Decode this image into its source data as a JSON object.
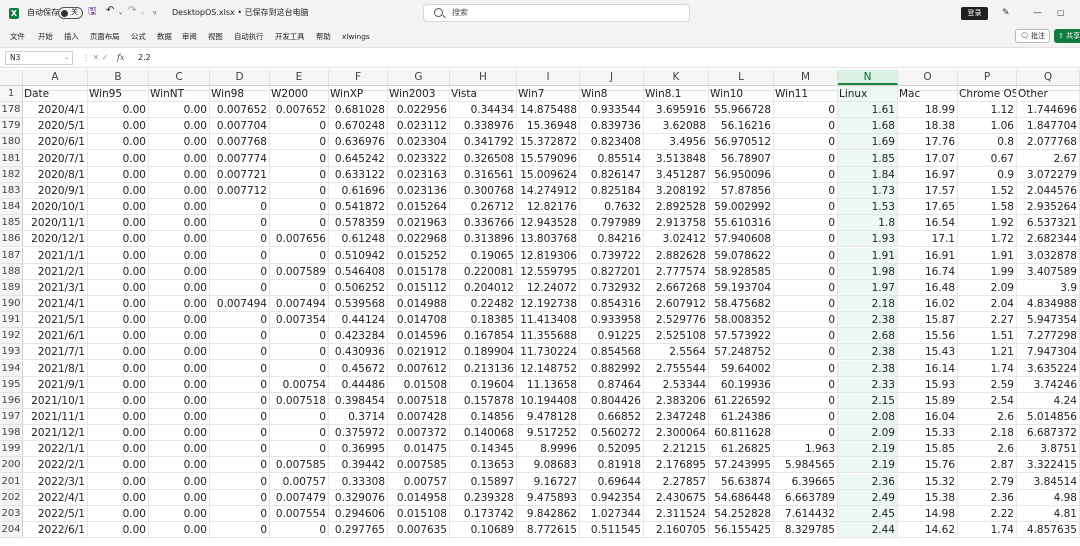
{
  "titlebar": {
    "app_icon": "excel-icon",
    "autosave_label": "自动保存",
    "autosave_state": "关",
    "filename": "DesktopOS.xlsx • 已保存到这台电脑",
    "search_placeholder": "搜索",
    "login_label": "登录",
    "icons": [
      "save-icon",
      "undo-icon",
      "redo-icon",
      "customize-icon",
      "pen-icon",
      "minimize-icon",
      "maximize-icon"
    ]
  },
  "menu": {
    "items": [
      "文件",
      "开始",
      "插入",
      "页面布局",
      "公式",
      "数据",
      "审阅",
      "视图",
      "自动执行",
      "开发工具",
      "帮助",
      "xlwings"
    ],
    "comment_label": "批注",
    "share_label": "共享"
  },
  "formula_bar": {
    "name_box": "N3",
    "fx": "fx",
    "value": "2.2"
  },
  "grid": {
    "columns": [
      "A",
      "B",
      "C",
      "D",
      "E",
      "F",
      "G",
      "H",
      "I",
      "J",
      "K",
      "L",
      "M",
      "N",
      "O",
      "P",
      "Q"
    ],
    "selected_column": "N",
    "header_row_number": "1",
    "headers": [
      "Date",
      "Win95",
      "WinNT",
      "Win98",
      "W2000",
      "WinXP",
      "Win2003",
      "Vista",
      "Win7",
      "Win8",
      "Win8.1",
      "Win10",
      "Win11",
      "Linux",
      "Mac",
      "Chrome OS",
      "Other"
    ],
    "rows": [
      {
        "n": "178",
        "c": [
          "2020/4/1",
          "0.00",
          "0.00",
          "0.007652",
          "0.007652",
          "0.681028",
          "0.022956",
          "0.34434",
          "14.875488",
          "0.933544",
          "3.695916",
          "55.966728",
          "0",
          "1.61",
          "18.99",
          "1.12",
          "1.744696"
        ]
      },
      {
        "n": "179",
        "c": [
          "2020/5/1",
          "0.00",
          "0.00",
          "0.007704",
          "0",
          "0.670248",
          "0.023112",
          "0.338976",
          "15.36948",
          "0.839736",
          "3.62088",
          "56.16216",
          "0",
          "1.68",
          "18.38",
          "1.06",
          "1.847704"
        ]
      },
      {
        "n": "180",
        "c": [
          "2020/6/1",
          "0.00",
          "0.00",
          "0.007768",
          "0",
          "0.636976",
          "0.023304",
          "0.341792",
          "15.372872",
          "0.823408",
          "3.4956",
          "56.970512",
          "0",
          "1.69",
          "17.76",
          "0.8",
          "2.077768"
        ]
      },
      {
        "n": "181",
        "c": [
          "2020/7/1",
          "0.00",
          "0.00",
          "0.007774",
          "0",
          "0.645242",
          "0.023322",
          "0.326508",
          "15.579096",
          "0.85514",
          "3.513848",
          "56.78907",
          "0",
          "1.85",
          "17.07",
          "0.67",
          "2.67"
        ]
      },
      {
        "n": "182",
        "c": [
          "2020/8/1",
          "0.00",
          "0.00",
          "0.007721",
          "0",
          "0.633122",
          "0.023163",
          "0.316561",
          "15.009624",
          "0.826147",
          "3.451287",
          "56.950096",
          "0",
          "1.84",
          "16.97",
          "0.9",
          "3.072279"
        ]
      },
      {
        "n": "183",
        "c": [
          "2020/9/1",
          "0.00",
          "0.00",
          "0.007712",
          "0",
          "0.61696",
          "0.023136",
          "0.300768",
          "14.274912",
          "0.825184",
          "3.208192",
          "57.87856",
          "0",
          "1.73",
          "17.57",
          "1.52",
          "2.044576"
        ]
      },
      {
        "n": "184",
        "c": [
          "2020/10/1",
          "0.00",
          "0.00",
          "0",
          "0",
          "0.541872",
          "0.015264",
          "0.26712",
          "12.82176",
          "0.7632",
          "2.892528",
          "59.002992",
          "0",
          "1.53",
          "17.65",
          "1.58",
          "2.935264"
        ]
      },
      {
        "n": "185",
        "c": [
          "2020/11/1",
          "0.00",
          "0.00",
          "0",
          "0",
          "0.578359",
          "0.021963",
          "0.336766",
          "12.943528",
          "0.797989",
          "2.913758",
          "55.610316",
          "0",
          "1.8",
          "16.54",
          "1.92",
          "6.537321"
        ]
      },
      {
        "n": "186",
        "c": [
          "2020/12/1",
          "0.00",
          "0.00",
          "0",
          "0.007656",
          "0.61248",
          "0.022968",
          "0.313896",
          "13.803768",
          "0.84216",
          "3.02412",
          "57.940608",
          "0",
          "1.93",
          "17.1",
          "1.72",
          "2.682344"
        ]
      },
      {
        "n": "187",
        "c": [
          "2021/1/1",
          "0.00",
          "0.00",
          "0",
          "0",
          "0.510942",
          "0.015252",
          "0.19065",
          "12.819306",
          "0.739722",
          "2.882628",
          "59.078622",
          "0",
          "1.91",
          "16.91",
          "1.91",
          "3.032878"
        ]
      },
      {
        "n": "188",
        "c": [
          "2021/2/1",
          "0.00",
          "0.00",
          "0",
          "0.007589",
          "0.546408",
          "0.015178",
          "0.220081",
          "12.559795",
          "0.827201",
          "2.777574",
          "58.928585",
          "0",
          "1.98",
          "16.74",
          "1.99",
          "3.407589"
        ]
      },
      {
        "n": "189",
        "c": [
          "2021/3/1",
          "0.00",
          "0.00",
          "0",
          "0",
          "0.506252",
          "0.015112",
          "0.204012",
          "12.24072",
          "0.732932",
          "2.667268",
          "59.193704",
          "0",
          "1.97",
          "16.48",
          "2.09",
          "3.9"
        ]
      },
      {
        "n": "190",
        "c": [
          "2021/4/1",
          "0.00",
          "0.00",
          "0.007494",
          "0.007494",
          "0.539568",
          "0.014988",
          "0.22482",
          "12.192738",
          "0.854316",
          "2.607912",
          "58.475682",
          "0",
          "2.18",
          "16.02",
          "2.04",
          "4.834988"
        ]
      },
      {
        "n": "191",
        "c": [
          "2021/5/1",
          "0.00",
          "0.00",
          "0",
          "0.007354",
          "0.44124",
          "0.014708",
          "0.18385",
          "11.413408",
          "0.933958",
          "2.529776",
          "58.008352",
          "0",
          "2.38",
          "15.87",
          "2.27",
          "5.947354"
        ]
      },
      {
        "n": "192",
        "c": [
          "2021/6/1",
          "0.00",
          "0.00",
          "0",
          "0",
          "0.423284",
          "0.014596",
          "0.167854",
          "11.355688",
          "0.91225",
          "2.525108",
          "57.573922",
          "0",
          "2.68",
          "15.56",
          "1.51",
          "7.277298"
        ]
      },
      {
        "n": "193",
        "c": [
          "2021/7/1",
          "0.00",
          "0.00",
          "0",
          "0",
          "0.430936",
          "0.021912",
          "0.189904",
          "11.730224",
          "0.854568",
          "2.5564",
          "57.248752",
          "0",
          "2.38",
          "15.43",
          "1.21",
          "7.947304"
        ]
      },
      {
        "n": "194",
        "c": [
          "2021/8/1",
          "0.00",
          "0.00",
          "0",
          "0",
          "0.45672",
          "0.007612",
          "0.213136",
          "12.148752",
          "0.882992",
          "2.755544",
          "59.64002",
          "0",
          "2.38",
          "16.14",
          "1.74",
          "3.635224"
        ]
      },
      {
        "n": "195",
        "c": [
          "2021/9/1",
          "0.00",
          "0.00",
          "0",
          "0.00754",
          "0.44486",
          "0.01508",
          "0.19604",
          "11.13658",
          "0.87464",
          "2.53344",
          "60.19936",
          "0",
          "2.33",
          "15.93",
          "2.59",
          "3.74246"
        ]
      },
      {
        "n": "196",
        "c": [
          "2021/10/1",
          "0.00",
          "0.00",
          "0",
          "0.007518",
          "0.398454",
          "0.007518",
          "0.157878",
          "10.194408",
          "0.804426",
          "2.383206",
          "61.226592",
          "0",
          "2.15",
          "15.89",
          "2.54",
          "4.24"
        ]
      },
      {
        "n": "197",
        "c": [
          "2021/11/1",
          "0.00",
          "0.00",
          "0",
          "0",
          "0.3714",
          "0.007428",
          "0.14856",
          "9.478128",
          "0.66852",
          "2.347248",
          "61.24386",
          "0",
          "2.08",
          "16.04",
          "2.6",
          "5.014856"
        ]
      },
      {
        "n": "198",
        "c": [
          "2021/12/1",
          "0.00",
          "0.00",
          "0",
          "0",
          "0.375972",
          "0.007372",
          "0.140068",
          "9.517252",
          "0.560272",
          "2.300064",
          "60.811628",
          "0",
          "2.09",
          "15.33",
          "2.18",
          "6.687372"
        ]
      },
      {
        "n": "199",
        "c": [
          "2022/1/1",
          "0.00",
          "0.00",
          "0",
          "0",
          "0.36995",
          "0.01475",
          "0.14345",
          "8.9996",
          "0.52095",
          "2.21215",
          "61.26825",
          "1.963",
          "2.19",
          "15.85",
          "2.6",
          "3.8751"
        ]
      },
      {
        "n": "200",
        "c": [
          "2022/2/1",
          "0.00",
          "0.00",
          "0",
          "0.007585",
          "0.39442",
          "0.007585",
          "0.13653",
          "9.08683",
          "0.81918",
          "2.176895",
          "57.243995",
          "5.984565",
          "2.19",
          "15.76",
          "2.87",
          "3.322415"
        ]
      },
      {
        "n": "201",
        "c": [
          "2022/3/1",
          "0.00",
          "0.00",
          "0",
          "0.00757",
          "0.33308",
          "0.00757",
          "0.15897",
          "9.16727",
          "0.69644",
          "2.27857",
          "56.63874",
          "6.39665",
          "2.36",
          "15.32",
          "2.79",
          "3.84514"
        ]
      },
      {
        "n": "202",
        "c": [
          "2022/4/1",
          "0.00",
          "0.00",
          "0",
          "0.007479",
          "0.329076",
          "0.014958",
          "0.239328",
          "9.475893",
          "0.942354",
          "2.430675",
          "54.686448",
          "6.663789",
          "2.49",
          "15.38",
          "2.36",
          "4.98"
        ]
      },
      {
        "n": "203",
        "c": [
          "2022/5/1",
          "0.00",
          "0.00",
          "0",
          "0.007554",
          "0.294606",
          "0.015108",
          "0.173742",
          "9.842862",
          "1.027344",
          "2.311524",
          "54.252828",
          "7.614432",
          "2.45",
          "14.98",
          "2.22",
          "4.81"
        ]
      },
      {
        "n": "204",
        "c": [
          "2022/6/1",
          "0.00",
          "0.00",
          "0",
          "0",
          "0.297765",
          "0.007635",
          "0.10689",
          "8.772615",
          "0.511545",
          "2.160705",
          "56.155425",
          "8.329785",
          "2.44",
          "14.62",
          "1.74",
          "4.857635"
        ]
      }
    ]
  }
}
